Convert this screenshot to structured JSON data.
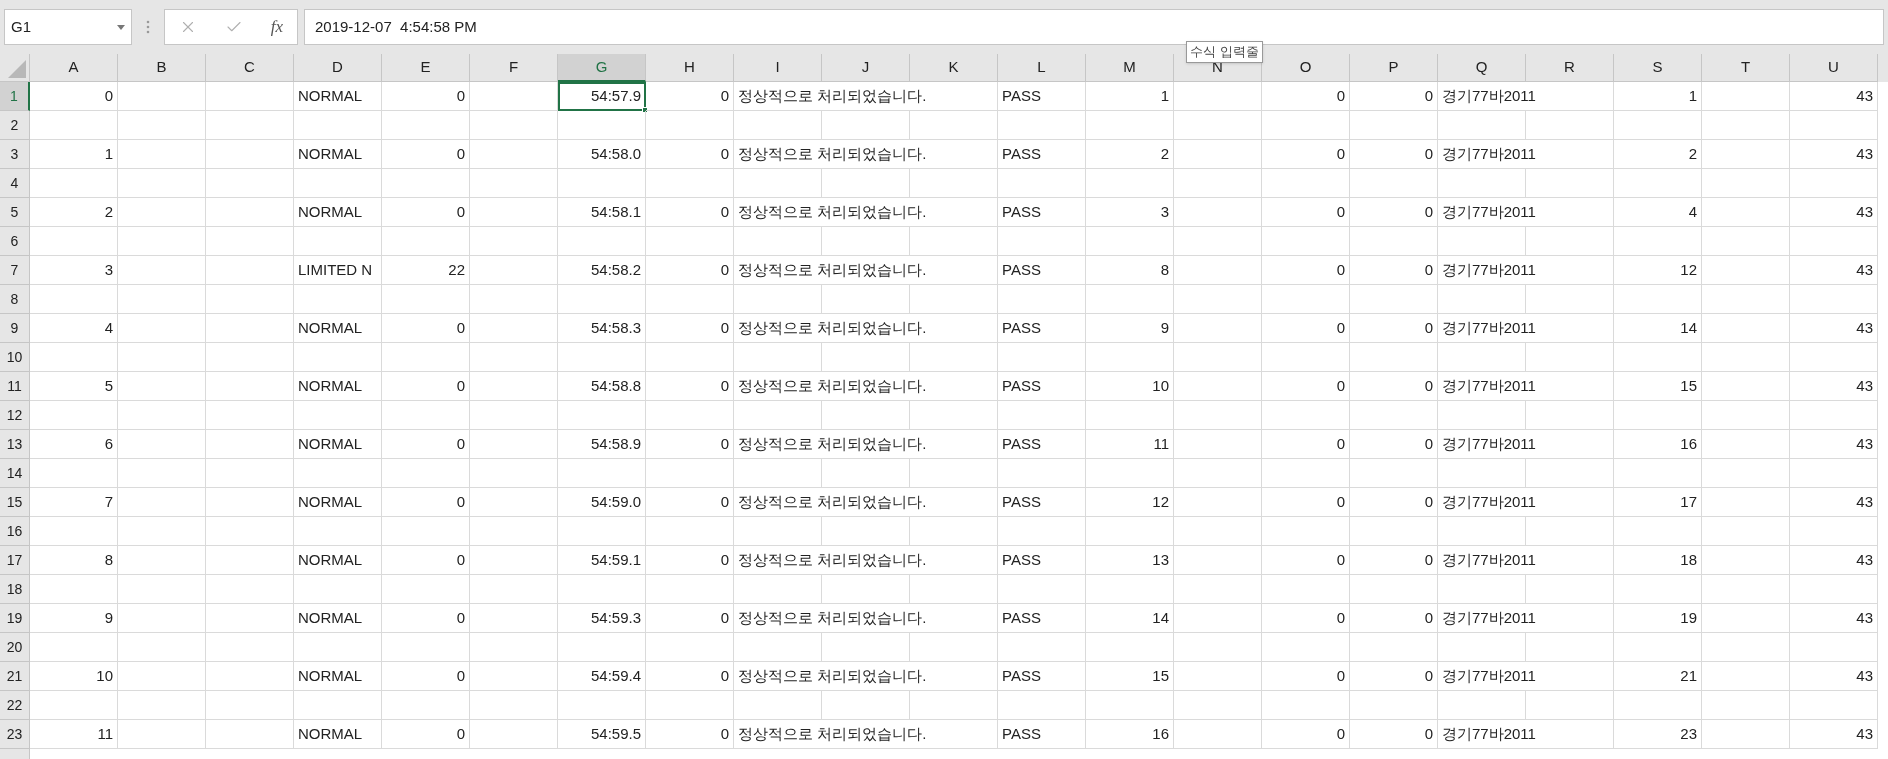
{
  "formula_bar": {
    "name_box": "G1",
    "function_label": "fx",
    "value": "2019-12-07  4:54:58 PM",
    "tooltip": "수식 입력줄"
  },
  "columns": [
    {
      "label": "A",
      "kind": "number",
      "selected": false
    },
    {
      "label": "B",
      "kind": "number",
      "selected": false
    },
    {
      "label": "C",
      "kind": "number",
      "selected": false
    },
    {
      "label": "D",
      "kind": "text",
      "selected": false
    },
    {
      "label": "E",
      "kind": "number",
      "selected": false
    },
    {
      "label": "F",
      "kind": "number",
      "selected": false
    },
    {
      "label": "G",
      "kind": "number",
      "selected": true
    },
    {
      "label": "H",
      "kind": "number",
      "selected": false
    },
    {
      "label": "I",
      "kind": "text",
      "selected": false
    },
    {
      "label": "J",
      "kind": "text",
      "selected": false
    },
    {
      "label": "K",
      "kind": "text",
      "selected": false
    },
    {
      "label": "L",
      "kind": "text",
      "selected": false
    },
    {
      "label": "M",
      "kind": "number",
      "selected": false
    },
    {
      "label": "N",
      "kind": "number",
      "selected": false
    },
    {
      "label": "O",
      "kind": "number",
      "selected": false
    },
    {
      "label": "P",
      "kind": "number",
      "selected": false
    },
    {
      "label": "Q",
      "kind": "text",
      "selected": false
    },
    {
      "label": "R",
      "kind": "text",
      "selected": false
    },
    {
      "label": "S",
      "kind": "number",
      "selected": false
    },
    {
      "label": "T",
      "kind": "number",
      "selected": false
    },
    {
      "label": "U",
      "kind": "number",
      "selected": false
    }
  ],
  "row_headers": [
    {
      "label": "1",
      "selected": true
    },
    {
      "label": "2",
      "selected": false
    },
    {
      "label": "3",
      "selected": false
    },
    {
      "label": "4",
      "selected": false
    },
    {
      "label": "5",
      "selected": false
    },
    {
      "label": "6",
      "selected": false
    },
    {
      "label": "7",
      "selected": false
    },
    {
      "label": "8",
      "selected": false
    },
    {
      "label": "9",
      "selected": false
    },
    {
      "label": "10",
      "selected": false
    },
    {
      "label": "11",
      "selected": false
    },
    {
      "label": "12",
      "selected": false
    },
    {
      "label": "13",
      "selected": false
    },
    {
      "label": "14",
      "selected": false
    },
    {
      "label": "15",
      "selected": false
    },
    {
      "label": "16",
      "selected": false
    },
    {
      "label": "17",
      "selected": false
    },
    {
      "label": "18",
      "selected": false
    },
    {
      "label": "19",
      "selected": false
    },
    {
      "label": "20",
      "selected": false
    },
    {
      "label": "21",
      "selected": false
    },
    {
      "label": "22",
      "selected": false
    },
    {
      "label": "23",
      "selected": false
    }
  ],
  "rows": [
    {
      "cells": {
        "A": "0",
        "D": "NORMAL",
        "E": "0",
        "G": "54:57.9",
        "H": "0",
        "I": "정상적으로 처리되었습니다.",
        "L": "PASS",
        "M": "1",
        "O": "0",
        "P": "0",
        "Q": "경기77바2011",
        "S": "1",
        "U": "43"
      }
    },
    {
      "cells": {
        "A": "1",
        "D": "NORMAL",
        "E": "0",
        "G": "54:58.0",
        "H": "0",
        "I": "정상적으로 처리되었습니다.",
        "L": "PASS",
        "M": "2",
        "O": "0",
        "P": "0",
        "Q": "경기77바2011",
        "S": "2",
        "U": "43"
      }
    },
    {
      "cells": {
        "A": "2",
        "D": "NORMAL",
        "E": "0",
        "G": "54:58.1",
        "H": "0",
        "I": "정상적으로 처리되었습니다.",
        "L": "PASS",
        "M": "3",
        "O": "0",
        "P": "0",
        "Q": "경기77바2011",
        "S": "4",
        "U": "43"
      }
    },
    {
      "cells": {
        "A": "3",
        "D": "LIMITED N",
        "E": "22",
        "G": "54:58.2",
        "H": "0",
        "I": "정상적으로 처리되었습니다.",
        "L": "PASS",
        "M": "8",
        "O": "0",
        "P": "0",
        "Q": "경기77바2011",
        "S": "12",
        "U": "43"
      }
    },
    {
      "cells": {
        "A": "4",
        "D": "NORMAL",
        "E": "0",
        "G": "54:58.3",
        "H": "0",
        "I": "정상적으로 처리되었습니다.",
        "L": "PASS",
        "M": "9",
        "O": "0",
        "P": "0",
        "Q": "경기77바2011",
        "S": "14",
        "U": "43"
      }
    },
    {
      "cells": {
        "A": "5",
        "D": "NORMAL",
        "E": "0",
        "G": "54:58.8",
        "H": "0",
        "I": "정상적으로 처리되었습니다.",
        "L": "PASS",
        "M": "10",
        "O": "0",
        "P": "0",
        "Q": "경기77바2011",
        "S": "15",
        "U": "43"
      }
    },
    {
      "cells": {
        "A": "6",
        "D": "NORMAL",
        "E": "0",
        "G": "54:58.9",
        "H": "0",
        "I": "정상적으로 처리되었습니다.",
        "L": "PASS",
        "M": "11",
        "O": "0",
        "P": "0",
        "Q": "경기77바2011",
        "S": "16",
        "U": "43"
      }
    },
    {
      "cells": {
        "A": "7",
        "D": "NORMAL",
        "E": "0",
        "G": "54:59.0",
        "H": "0",
        "I": "정상적으로 처리되었습니다.",
        "L": "PASS",
        "M": "12",
        "O": "0",
        "P": "0",
        "Q": "경기77바2011",
        "S": "17",
        "U": "43"
      }
    },
    {
      "cells": {
        "A": "8",
        "D": "NORMAL",
        "E": "0",
        "G": "54:59.1",
        "H": "0",
        "I": "정상적으로 처리되었습니다.",
        "L": "PASS",
        "M": "13",
        "O": "0",
        "P": "0",
        "Q": "경기77바2011",
        "S": "18",
        "U": "43"
      }
    },
    {
      "cells": {
        "A": "9",
        "D": "NORMAL",
        "E": "0",
        "G": "54:59.3",
        "H": "0",
        "I": "정상적으로 처리되었습니다.",
        "L": "PASS",
        "M": "14",
        "O": "0",
        "P": "0",
        "Q": "경기77바2011",
        "S": "19",
        "U": "43"
      }
    },
    {
      "cells": {
        "A": "10",
        "D": "NORMAL",
        "E": "0",
        "G": "54:59.4",
        "H": "0",
        "I": "정상적으로 처리되었습니다.",
        "L": "PASS",
        "M": "15",
        "O": "0",
        "P": "0",
        "Q": "경기77바2011",
        "S": "21",
        "U": "43"
      }
    },
    {
      "cells": {
        "A": "11",
        "D": "NORMAL",
        "E": "0",
        "G": "54:59.5",
        "H": "0",
        "I": "정상적으로 처리되었습니다.",
        "L": "PASS",
        "M": "16",
        "O": "0",
        "P": "0",
        "Q": "경기77바2011",
        "S": "23",
        "U": "43"
      }
    }
  ]
}
